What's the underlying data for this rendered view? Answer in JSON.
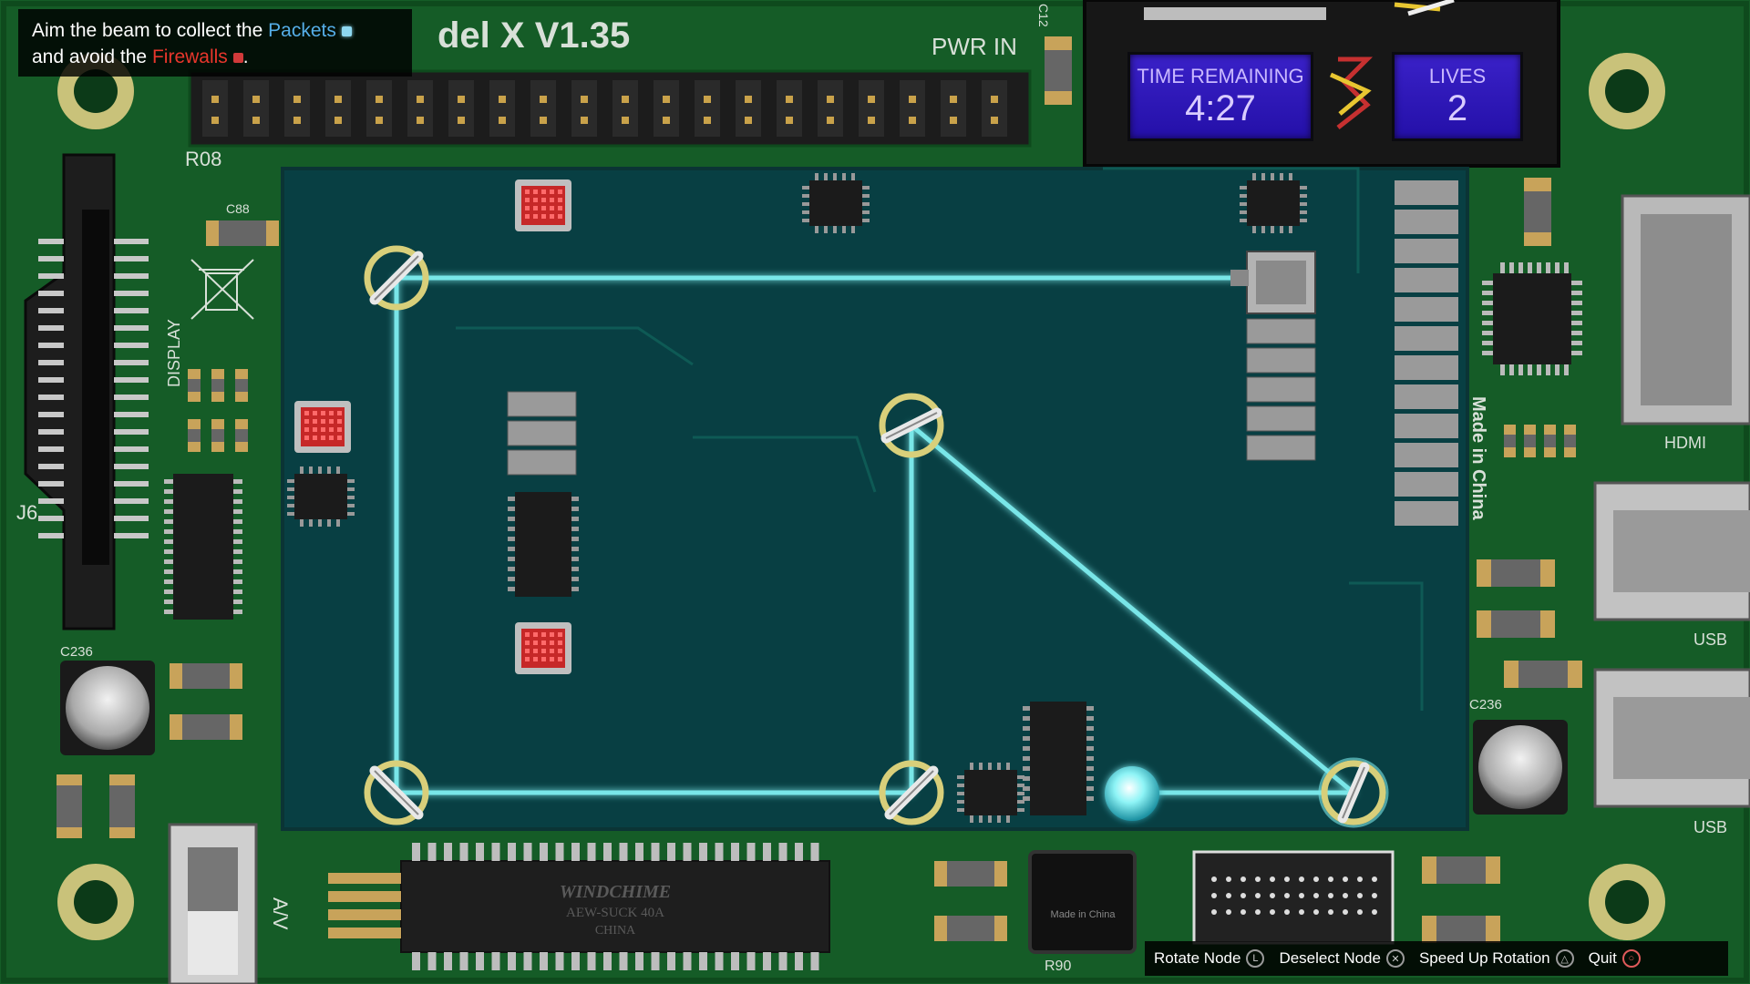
{
  "hint": {
    "line1_prefix": "Aim the beam to collect the",
    "packets_word": "Packets",
    "line2_prefix": "and avoid the",
    "firewalls_word": "Firewalls",
    "period": ".",
    "packet_icon": "packet-icon",
    "firewall_icon": "firewall-icon"
  },
  "board": {
    "title": "del X V1.35",
    "pwr_label": "PWR IN",
    "r08": "R08",
    "display_label": "DISPLAY",
    "j6": "J6",
    "hdmi": "HDMI",
    "usb1": "USB",
    "usb2": "USB",
    "av": "A/V",
    "r90": "R90",
    "made_in_china": "Made in China",
    "made_in_china_small": "Made in China",
    "chip_brand": "WINDCHIME",
    "chip_model": "AEW-SUCK 40A",
    "chip_country": "CHINA",
    "c236_left": "C236",
    "c236_right": "C236",
    "c12": "C12",
    "c88": "C88"
  },
  "hud": {
    "time_label": "TIME REMAINING",
    "time_value": "4:27",
    "lives_label": "LIVES",
    "lives_value": "2"
  },
  "controls": [
    {
      "label": "Rotate Node",
      "icon": "left-stick-icon",
      "glyph": "L"
    },
    {
      "label": "Deselect Node",
      "icon": "cross-button-icon",
      "glyph": "✕"
    },
    {
      "label": "Speed Up Rotation",
      "icon": "triangle-button-icon",
      "glyph": "△"
    },
    {
      "label": "Quit",
      "icon": "circle-button-icon",
      "glyph": "○"
    }
  ],
  "colors": {
    "pcb": "#145a25",
    "play_area": "#083f43",
    "beam": "#6fe3e6",
    "node_ring": "#d8cf7a",
    "firewall": "#d13a3a",
    "packet": "#8ed8f0",
    "hud_screen": "#2f18b8"
  }
}
